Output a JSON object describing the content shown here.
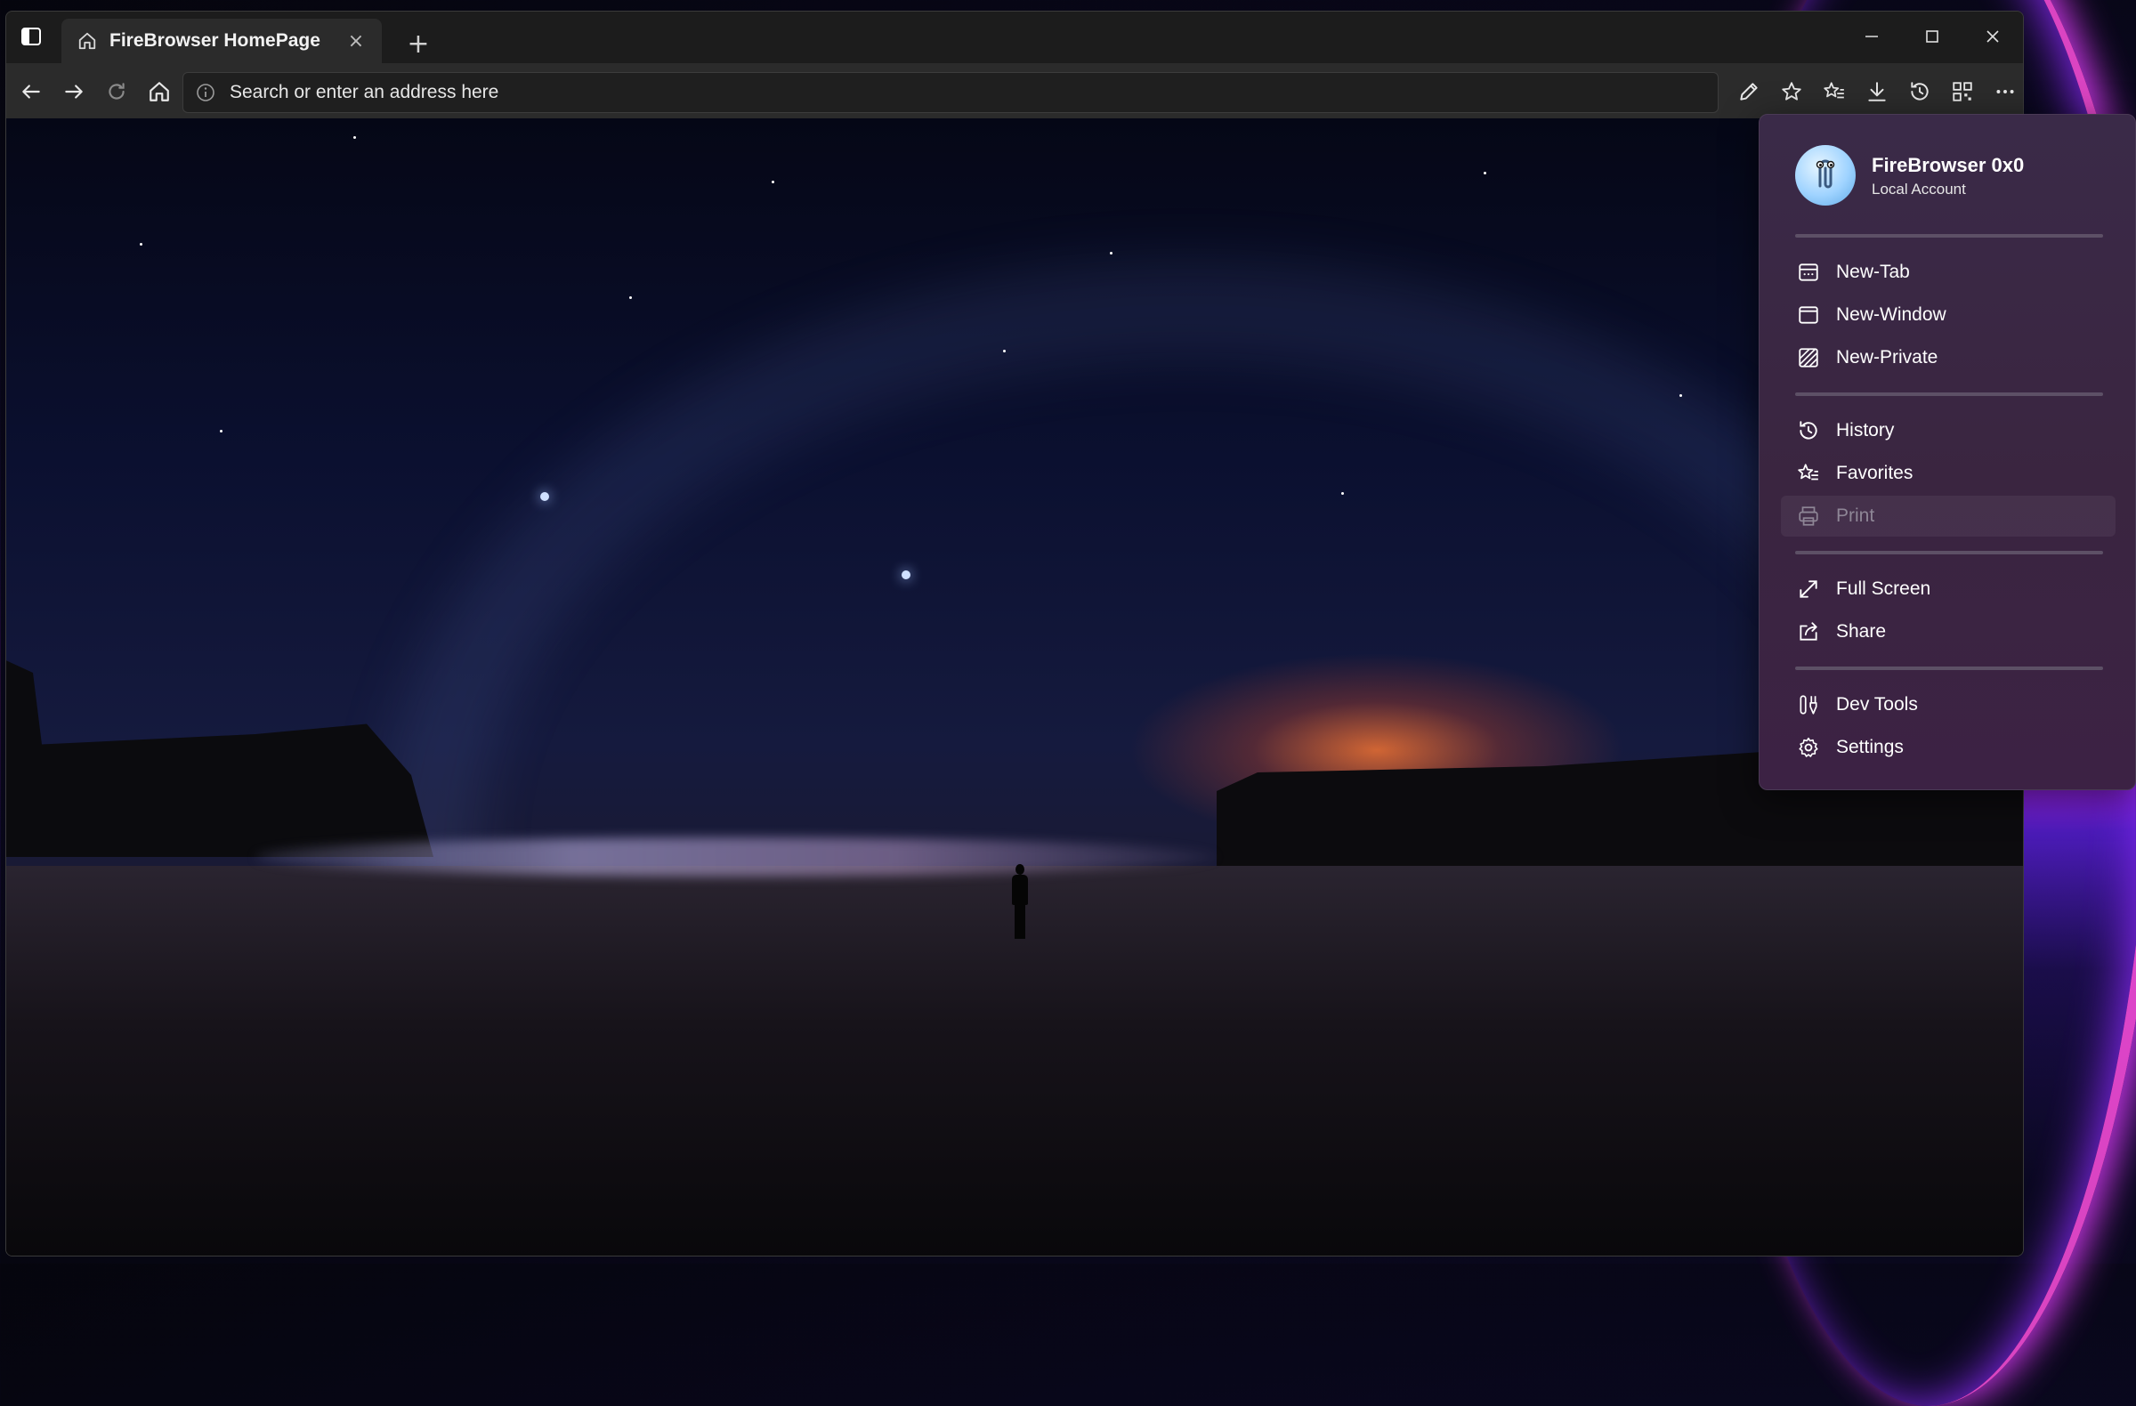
{
  "tab": {
    "title": "FireBrowser HomePage",
    "close": "×"
  },
  "new_tab": "+",
  "address": {
    "text": "Search or enter an address here"
  },
  "menu": {
    "profile": {
      "name": "FireBrowser 0x0",
      "subtitle": "Local Account"
    },
    "items": [
      {
        "label": "New-Tab",
        "icon": "new-tab-icon"
      },
      {
        "label": "New-Window",
        "icon": "window-icon"
      },
      {
        "label": "New-Private",
        "icon": "private-icon"
      },
      {
        "label": "History",
        "icon": "history-icon"
      },
      {
        "label": "Favorites",
        "icon": "favorites-icon"
      },
      {
        "label": "Print",
        "icon": "print-icon",
        "disabled": true
      },
      {
        "label": "Full Screen",
        "icon": "fullscreen-icon"
      },
      {
        "label": "Share",
        "icon": "share-icon"
      },
      {
        "label": "Dev Tools",
        "icon": "devtools-icon"
      },
      {
        "label": "Settings",
        "icon": "gear-icon"
      }
    ]
  },
  "colors": {
    "menu_bg": "#3a2a48",
    "accent": "#ff4fe0",
    "toolbar": "#2b2b2b"
  }
}
